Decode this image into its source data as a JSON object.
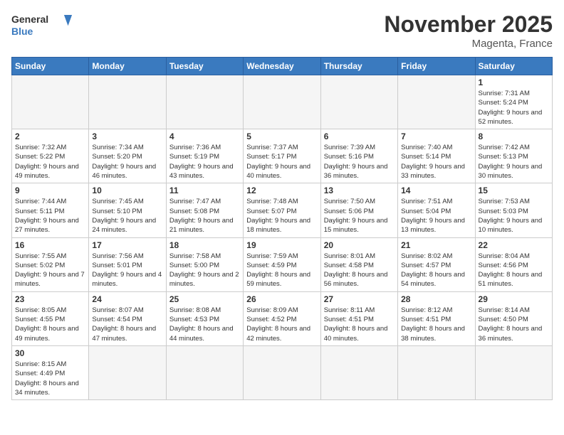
{
  "header": {
    "logo_general": "General",
    "logo_blue": "Blue",
    "month_title": "November 2025",
    "location": "Magenta, France"
  },
  "weekdays": [
    "Sunday",
    "Monday",
    "Tuesday",
    "Wednesday",
    "Thursday",
    "Friday",
    "Saturday"
  ],
  "weeks": [
    [
      {
        "day": "",
        "info": ""
      },
      {
        "day": "",
        "info": ""
      },
      {
        "day": "",
        "info": ""
      },
      {
        "day": "",
        "info": ""
      },
      {
        "day": "",
        "info": ""
      },
      {
        "day": "",
        "info": ""
      },
      {
        "day": "1",
        "info": "Sunrise: 7:31 AM\nSunset: 5:24 PM\nDaylight: 9 hours\nand 52 minutes."
      }
    ],
    [
      {
        "day": "2",
        "info": "Sunrise: 7:32 AM\nSunset: 5:22 PM\nDaylight: 9 hours\nand 49 minutes."
      },
      {
        "day": "3",
        "info": "Sunrise: 7:34 AM\nSunset: 5:20 PM\nDaylight: 9 hours\nand 46 minutes."
      },
      {
        "day": "4",
        "info": "Sunrise: 7:36 AM\nSunset: 5:19 PM\nDaylight: 9 hours\nand 43 minutes."
      },
      {
        "day": "5",
        "info": "Sunrise: 7:37 AM\nSunset: 5:17 PM\nDaylight: 9 hours\nand 40 minutes."
      },
      {
        "day": "6",
        "info": "Sunrise: 7:39 AM\nSunset: 5:16 PM\nDaylight: 9 hours\nand 36 minutes."
      },
      {
        "day": "7",
        "info": "Sunrise: 7:40 AM\nSunset: 5:14 PM\nDaylight: 9 hours\nand 33 minutes."
      },
      {
        "day": "8",
        "info": "Sunrise: 7:42 AM\nSunset: 5:13 PM\nDaylight: 9 hours\nand 30 minutes."
      }
    ],
    [
      {
        "day": "9",
        "info": "Sunrise: 7:44 AM\nSunset: 5:11 PM\nDaylight: 9 hours\nand 27 minutes."
      },
      {
        "day": "10",
        "info": "Sunrise: 7:45 AM\nSunset: 5:10 PM\nDaylight: 9 hours\nand 24 minutes."
      },
      {
        "day": "11",
        "info": "Sunrise: 7:47 AM\nSunset: 5:08 PM\nDaylight: 9 hours\nand 21 minutes."
      },
      {
        "day": "12",
        "info": "Sunrise: 7:48 AM\nSunset: 5:07 PM\nDaylight: 9 hours\nand 18 minutes."
      },
      {
        "day": "13",
        "info": "Sunrise: 7:50 AM\nSunset: 5:06 PM\nDaylight: 9 hours\nand 15 minutes."
      },
      {
        "day": "14",
        "info": "Sunrise: 7:51 AM\nSunset: 5:04 PM\nDaylight: 9 hours\nand 13 minutes."
      },
      {
        "day": "15",
        "info": "Sunrise: 7:53 AM\nSunset: 5:03 PM\nDaylight: 9 hours\nand 10 minutes."
      }
    ],
    [
      {
        "day": "16",
        "info": "Sunrise: 7:55 AM\nSunset: 5:02 PM\nDaylight: 9 hours\nand 7 minutes."
      },
      {
        "day": "17",
        "info": "Sunrise: 7:56 AM\nSunset: 5:01 PM\nDaylight: 9 hours\nand 4 minutes."
      },
      {
        "day": "18",
        "info": "Sunrise: 7:58 AM\nSunset: 5:00 PM\nDaylight: 9 hours\nand 2 minutes."
      },
      {
        "day": "19",
        "info": "Sunrise: 7:59 AM\nSunset: 4:59 PM\nDaylight: 8 hours\nand 59 minutes."
      },
      {
        "day": "20",
        "info": "Sunrise: 8:01 AM\nSunset: 4:58 PM\nDaylight: 8 hours\nand 56 minutes."
      },
      {
        "day": "21",
        "info": "Sunrise: 8:02 AM\nSunset: 4:57 PM\nDaylight: 8 hours\nand 54 minutes."
      },
      {
        "day": "22",
        "info": "Sunrise: 8:04 AM\nSunset: 4:56 PM\nDaylight: 8 hours\nand 51 minutes."
      }
    ],
    [
      {
        "day": "23",
        "info": "Sunrise: 8:05 AM\nSunset: 4:55 PM\nDaylight: 8 hours\nand 49 minutes."
      },
      {
        "day": "24",
        "info": "Sunrise: 8:07 AM\nSunset: 4:54 PM\nDaylight: 8 hours\nand 47 minutes."
      },
      {
        "day": "25",
        "info": "Sunrise: 8:08 AM\nSunset: 4:53 PM\nDaylight: 8 hours\nand 44 minutes."
      },
      {
        "day": "26",
        "info": "Sunrise: 8:09 AM\nSunset: 4:52 PM\nDaylight: 8 hours\nand 42 minutes."
      },
      {
        "day": "27",
        "info": "Sunrise: 8:11 AM\nSunset: 4:51 PM\nDaylight: 8 hours\nand 40 minutes."
      },
      {
        "day": "28",
        "info": "Sunrise: 8:12 AM\nSunset: 4:51 PM\nDaylight: 8 hours\nand 38 minutes."
      },
      {
        "day": "29",
        "info": "Sunrise: 8:14 AM\nSunset: 4:50 PM\nDaylight: 8 hours\nand 36 minutes."
      }
    ],
    [
      {
        "day": "30",
        "info": "Sunrise: 8:15 AM\nSunset: 4:49 PM\nDaylight: 8 hours\nand 34 minutes."
      },
      {
        "day": "",
        "info": ""
      },
      {
        "day": "",
        "info": ""
      },
      {
        "day": "",
        "info": ""
      },
      {
        "day": "",
        "info": ""
      },
      {
        "day": "",
        "info": ""
      },
      {
        "day": "",
        "info": ""
      }
    ]
  ]
}
